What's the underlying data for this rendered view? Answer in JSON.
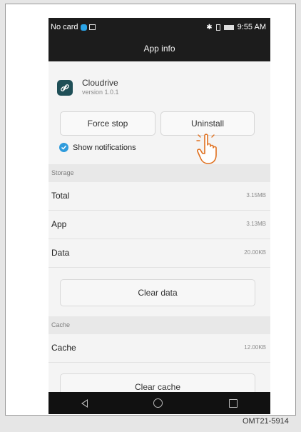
{
  "status_bar": {
    "carrier": "No card",
    "time": "9:55 AM"
  },
  "app_bar": {
    "title": "App info"
  },
  "app": {
    "name": "Cloudrive",
    "version": "version 1.0.1",
    "icon": "link-icon"
  },
  "buttons": {
    "force_stop": "Force stop",
    "uninstall": "Uninstall"
  },
  "notifications": {
    "label": "Show notifications",
    "checked": true
  },
  "storage": {
    "header": "Storage",
    "rows": [
      {
        "label": "Total",
        "value": "3.15MB"
      },
      {
        "label": "App",
        "value": "3.13MB"
      },
      {
        "label": "Data",
        "value": "20.00KB"
      }
    ],
    "clear_button": "Clear data"
  },
  "cache": {
    "header": "Cache",
    "rows": [
      {
        "label": "Cache",
        "value": "12.00KB"
      }
    ],
    "clear_button": "Clear cache"
  },
  "nav": {
    "icons": [
      "back-icon",
      "home-icon",
      "recents-icon"
    ]
  },
  "figure_caption": "OMT21-5914",
  "colors": {
    "accent": "#2e9bdc",
    "bar": "#1c1c1c",
    "app_icon": "#1f4f57"
  }
}
